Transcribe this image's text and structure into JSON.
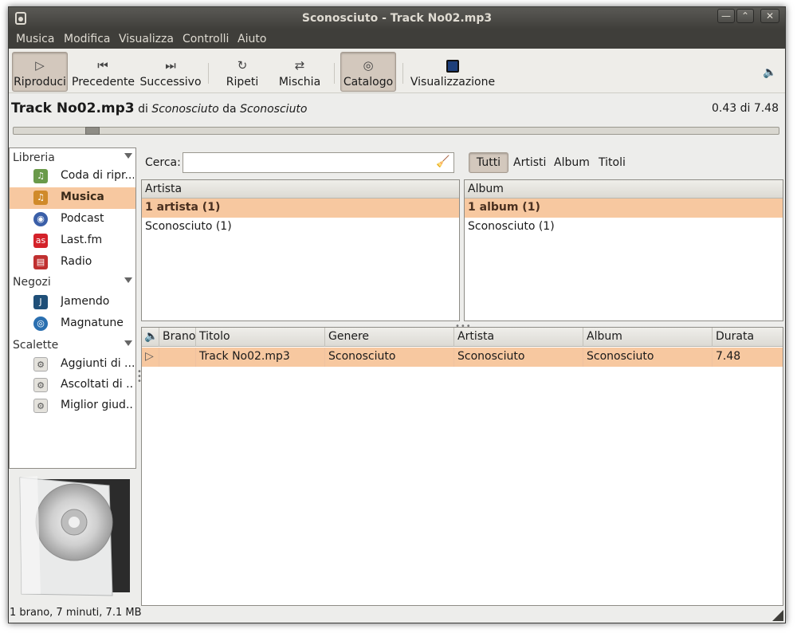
{
  "window": {
    "title": "Sconosciuto - Track No02.mp3"
  },
  "menu": [
    "Musica",
    "Modifica",
    "Visualizza",
    "Controlli",
    "Aiuto"
  ],
  "toolbar": {
    "play": "Riproduci",
    "prev": "Precedente",
    "next": "Successivo",
    "repeat": "Ripeti",
    "shuffle": "Mischia",
    "browse": "Catalogo",
    "visual": "Visualizzazione"
  },
  "now_playing": {
    "title": "Track No02.mp3",
    "by": "di",
    "artist": "Sconosciuto",
    "from": "da",
    "album": "Sconosciuto",
    "time": "0.43 di 7.48",
    "progress_fraction": 0.0957
  },
  "sidebar": {
    "groups": [
      {
        "label": "Libreria",
        "items": [
          "Coda di ripr...",
          "Musica",
          "Podcast",
          "Last.fm",
          "Radio"
        ]
      },
      {
        "label": "Negozi",
        "items": [
          "Jamendo",
          "Magnatune"
        ]
      },
      {
        "label": "Scalette",
        "items": [
          "Aggiunti di ...",
          "Ascoltati di ...",
          "Miglior giud..."
        ]
      }
    ],
    "selected": "Musica"
  },
  "search": {
    "label": "Cerca:",
    "value": "",
    "placeholder": ""
  },
  "filters": [
    "Tutti",
    "Artisti",
    "Album",
    "Titoli"
  ],
  "artist_pane": {
    "header": "Artista",
    "rows": [
      "1 artista (1)",
      "Sconosciuto (1)"
    ]
  },
  "album_pane": {
    "header": "Album",
    "rows": [
      "1 album (1)",
      "Sconosciuto (1)"
    ]
  },
  "tracks": {
    "columns": [
      "Brano",
      "Titolo",
      "Genere",
      "Artista",
      "Album",
      "Durata"
    ],
    "rows": [
      {
        "track": "",
        "title": "Track No02.mp3",
        "genre": "Sconosciuto",
        "artist": "Sconosciuto",
        "album": "Sconosciuto",
        "duration": "7.48"
      }
    ]
  },
  "status": "1 brano, 7 minuti, 7.1 MB",
  "colors": {
    "selection": "#f7c8a0",
    "titlebar": "#3f3e3a",
    "pressed": "#d3c8bd"
  }
}
